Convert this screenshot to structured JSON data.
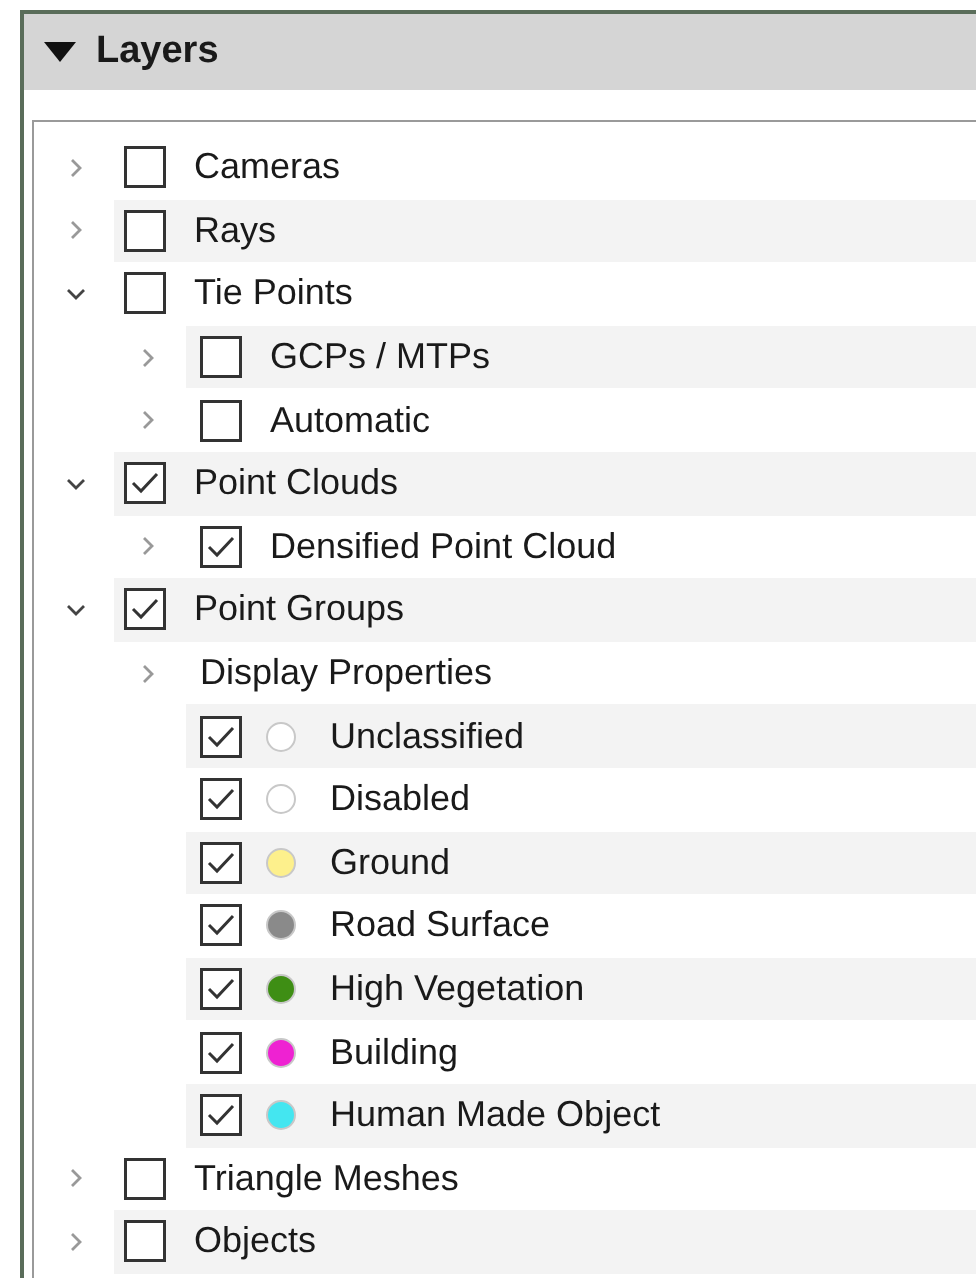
{
  "layers": {
    "title": "Layers",
    "expanded": true,
    "items": [
      {
        "label": "Cameras",
        "kind": "layer",
        "checked": false,
        "expanded": false
      },
      {
        "label": "Rays",
        "kind": "layer",
        "checked": false,
        "expanded": false
      },
      {
        "label": "Tie Points",
        "kind": "layer",
        "checked": false,
        "expanded": true,
        "children": [
          {
            "label": "GCPs / MTPs",
            "kind": "layer",
            "checked": false,
            "expanded": false
          },
          {
            "label": "Automatic",
            "kind": "layer",
            "checked": false,
            "expanded": false
          }
        ]
      },
      {
        "label": "Point Clouds",
        "kind": "layer",
        "checked": true,
        "expanded": true,
        "children": [
          {
            "label": "Densified Point Cloud",
            "kind": "layer",
            "checked": true,
            "expanded": false
          }
        ]
      },
      {
        "label": "Point Groups",
        "kind": "layer",
        "checked": true,
        "expanded": true,
        "children": [
          {
            "label": "Display Properties",
            "kind": "group",
            "expanded": false
          },
          {
            "label": "Unclassified",
            "kind": "class",
            "checked": true,
            "color": "#ffffff"
          },
          {
            "label": "Disabled",
            "kind": "class",
            "checked": true,
            "color": "#ffffff"
          },
          {
            "label": "Ground",
            "kind": "class",
            "checked": true,
            "color": "#fdf08c"
          },
          {
            "label": "Road Surface",
            "kind": "class",
            "checked": true,
            "color": "#8a8a8a"
          },
          {
            "label": "High Vegetation",
            "kind": "class",
            "checked": true,
            "color": "#3e8e14"
          },
          {
            "label": "Building",
            "kind": "class",
            "checked": true,
            "color": "#ee22d2"
          },
          {
            "label": "Human Made Object",
            "kind": "class",
            "checked": true,
            "color": "#44e6f0"
          }
        ]
      },
      {
        "label": "Triangle Meshes",
        "kind": "layer",
        "checked": false,
        "expanded": false
      },
      {
        "label": "Objects",
        "kind": "layer",
        "checked": false,
        "expanded": false
      }
    ]
  }
}
